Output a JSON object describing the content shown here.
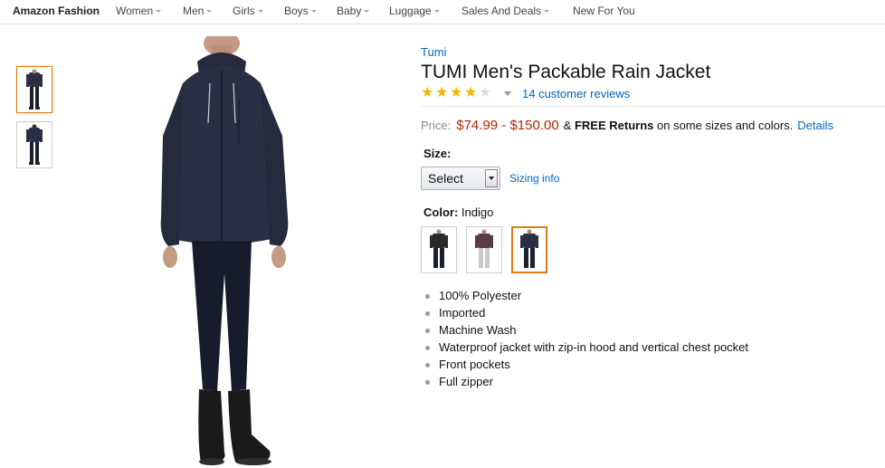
{
  "nav": {
    "brand": "Amazon Fashion",
    "items": [
      {
        "label": "Women",
        "caret": true
      },
      {
        "label": "Men",
        "caret": true
      },
      {
        "label": "Girls",
        "caret": true
      },
      {
        "label": "Boys",
        "caret": true
      },
      {
        "label": "Baby",
        "caret": true
      },
      {
        "label": "Luggage",
        "caret": true
      },
      {
        "label": "Sales And Deals",
        "caret": true
      },
      {
        "label": "New For You",
        "caret": false
      }
    ]
  },
  "thumbnails": [
    {
      "view": "front",
      "selected": true,
      "icon": "jacket-front-thumbnail"
    },
    {
      "view": "back",
      "selected": false,
      "icon": "jacket-back-thumbnail"
    }
  ],
  "product": {
    "brand": "Tumi",
    "title": "TUMI Men's Packable Rain Jacket",
    "rating": {
      "stars": 4,
      "out_of": 5
    },
    "reviews_link": "14 customer reviews",
    "price_label": "Price:",
    "price": "$74.99 - $150.00",
    "shipping_prefix": "&",
    "free_returns": "FREE Returns",
    "shipping_suffix": "on some sizes and colors.",
    "details_link": "Details",
    "size_label": "Size:",
    "size_select_value": "Select",
    "sizing_info_link": "Sizing info",
    "color_label": "Color:",
    "color_value": "Indigo",
    "color_swatches": [
      {
        "name": "black",
        "jacket_color": "#2a2a2a",
        "selected": false
      },
      {
        "name": "burgundy",
        "jacket_color": "#5a3a45",
        "selected": false
      },
      {
        "name": "indigo",
        "jacket_color": "#2a2f44",
        "selected": true
      }
    ],
    "features": [
      "100% Polyester",
      "Imported",
      "Machine Wash",
      "Waterproof jacket with zip-in hood and vertical chest pocket",
      "Front pockets",
      "Full zipper"
    ]
  },
  "colors": {
    "link": "#0066c0",
    "price": "#b12704",
    "star": "#f4b400",
    "selected_border": "#e47911"
  }
}
